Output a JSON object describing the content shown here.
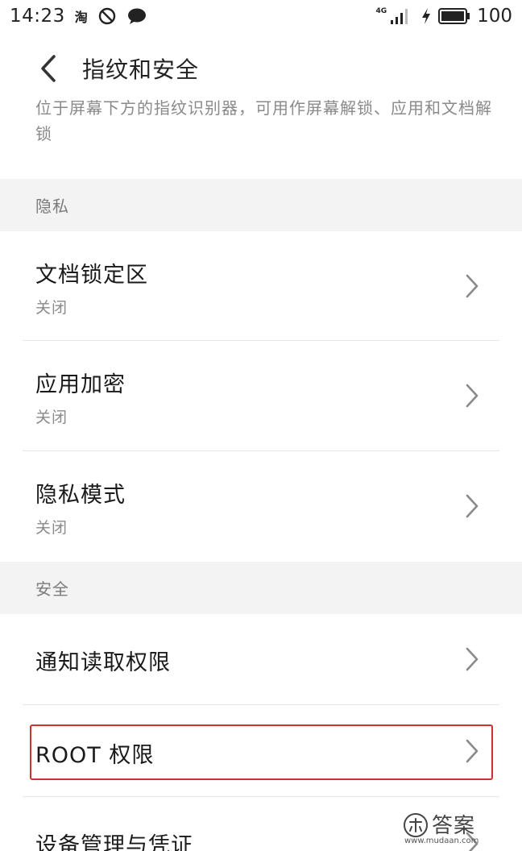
{
  "status_bar": {
    "time": "14:23",
    "app_badge": "淘",
    "network": "4G",
    "battery_level": "100"
  },
  "header": {
    "title": "指纹和安全"
  },
  "fingerprint_description": "位于屏幕下方的指纹识别器，可用作屏幕解锁、应用和文档解锁",
  "sections": [
    {
      "header": "隐私",
      "items": [
        {
          "title": "文档锁定区",
          "subtitle": "关闭"
        },
        {
          "title": "应用加密",
          "subtitle": "关闭"
        },
        {
          "title": "隐私模式",
          "subtitle": "关闭"
        }
      ]
    },
    {
      "header": "安全",
      "items": [
        {
          "title": "通知读取权限"
        },
        {
          "title": "ROOT 权限",
          "highlighted": true
        },
        {
          "title": "设备管理与凭证"
        }
      ]
    }
  ],
  "watermark": {
    "name": "答案",
    "url": "www.mudaan.com"
  },
  "colors": {
    "highlight": "#d32f2f",
    "section_bg": "#f3f3f3",
    "secondary_text": "#8a8a8a"
  }
}
